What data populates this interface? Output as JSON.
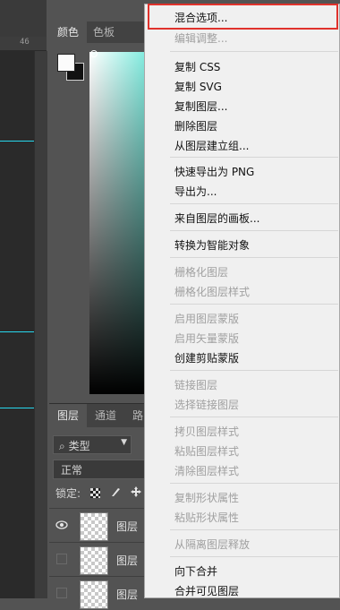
{
  "ruler": {
    "mark": "46"
  },
  "color_panel": {
    "tabs": [
      {
        "label": "颜色"
      },
      {
        "label": "色板"
      }
    ],
    "foreground": "#fbfbfb",
    "background": "#111111",
    "hue_color": "#5fe6d6"
  },
  "layers_panel": {
    "tabs": [
      {
        "label": "图层"
      },
      {
        "label": "通道"
      },
      {
        "label": "路"
      }
    ],
    "filter_label": "类型",
    "blend_mode": "正常",
    "lock_label": "锁定:",
    "layers": [
      {
        "name": "图层",
        "visible": true
      },
      {
        "name": "图层",
        "visible": false
      },
      {
        "name": "图层",
        "visible": false
      }
    ]
  },
  "context_menu": {
    "items": [
      {
        "label": "混合选项...",
        "enabled": true,
        "highlighted": true
      },
      {
        "label": "编辑调整...",
        "enabled": false
      },
      {
        "label": "复制 CSS",
        "enabled": true
      },
      {
        "label": "复制 SVG",
        "enabled": true
      },
      {
        "label": "复制图层...",
        "enabled": true
      },
      {
        "label": "删除图层",
        "enabled": true
      },
      {
        "label": "从图层建立组...",
        "enabled": true
      },
      {
        "label": "快速导出为 PNG",
        "enabled": true
      },
      {
        "label": "导出为...",
        "enabled": true
      },
      {
        "label": "来自图层的画板...",
        "enabled": true
      },
      {
        "label": "转换为智能对象",
        "enabled": true
      },
      {
        "label": "栅格化图层",
        "enabled": false
      },
      {
        "label": "栅格化图层样式",
        "enabled": false
      },
      {
        "label": "启用图层蒙版",
        "enabled": false
      },
      {
        "label": "启用矢量蒙版",
        "enabled": false
      },
      {
        "label": "创建剪贴蒙版",
        "enabled": true
      },
      {
        "label": "链接图层",
        "enabled": false
      },
      {
        "label": "选择链接图层",
        "enabled": false
      },
      {
        "label": "拷贝图层样式",
        "enabled": false
      },
      {
        "label": "粘贴图层样式",
        "enabled": false
      },
      {
        "label": "清除图层样式",
        "enabled": false
      },
      {
        "label": "复制形状属性",
        "enabled": false
      },
      {
        "label": "粘贴形状属性",
        "enabled": false
      },
      {
        "label": "从隔离图层释放",
        "enabled": false
      },
      {
        "label": "向下合并",
        "enabled": true
      },
      {
        "label": "合并可见图层",
        "enabled": true
      }
    ]
  }
}
